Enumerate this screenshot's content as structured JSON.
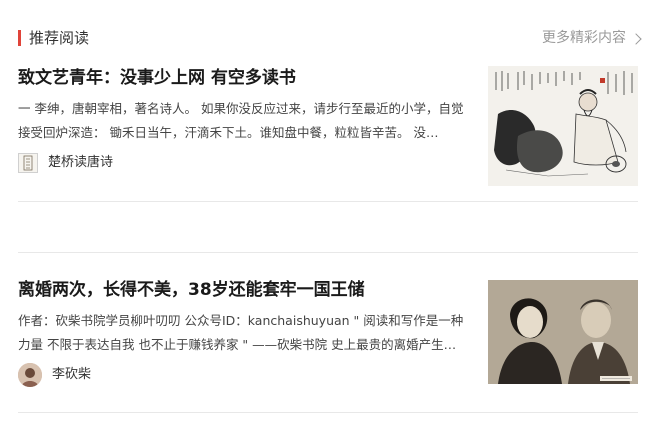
{
  "section": {
    "title": "推荐阅读",
    "more_label": "更多精彩内容"
  },
  "articles": [
    {
      "title": "致文艺青年：没事少上网 有空多读书",
      "summary": "一 李绅，唐朝宰相，著名诗人。 如果你没反应过来，请步行至最近的小学，自觉接受回炉深造： 锄禾日当午，汗滴禾下土。谁知盘中餐，粒粒皆辛苦。 没…",
      "author": "楚桥读唐诗",
      "thumbnail": "ink-painting-scholar"
    },
    {
      "title": "离婚两次，长得不美，38岁还能套牢一国王储",
      "summary": "作者：砍柴书院学员柳叶叨叨 公众号ID：kanchaishuyuan \" 阅读和写作是一种力量 不限于表达自我 也不止于赚钱养家 \" ——砍柴书院 史上最贵的离婚产生…",
      "author": "李砍柴",
      "thumbnail": "vintage-couple-photo"
    }
  ]
}
